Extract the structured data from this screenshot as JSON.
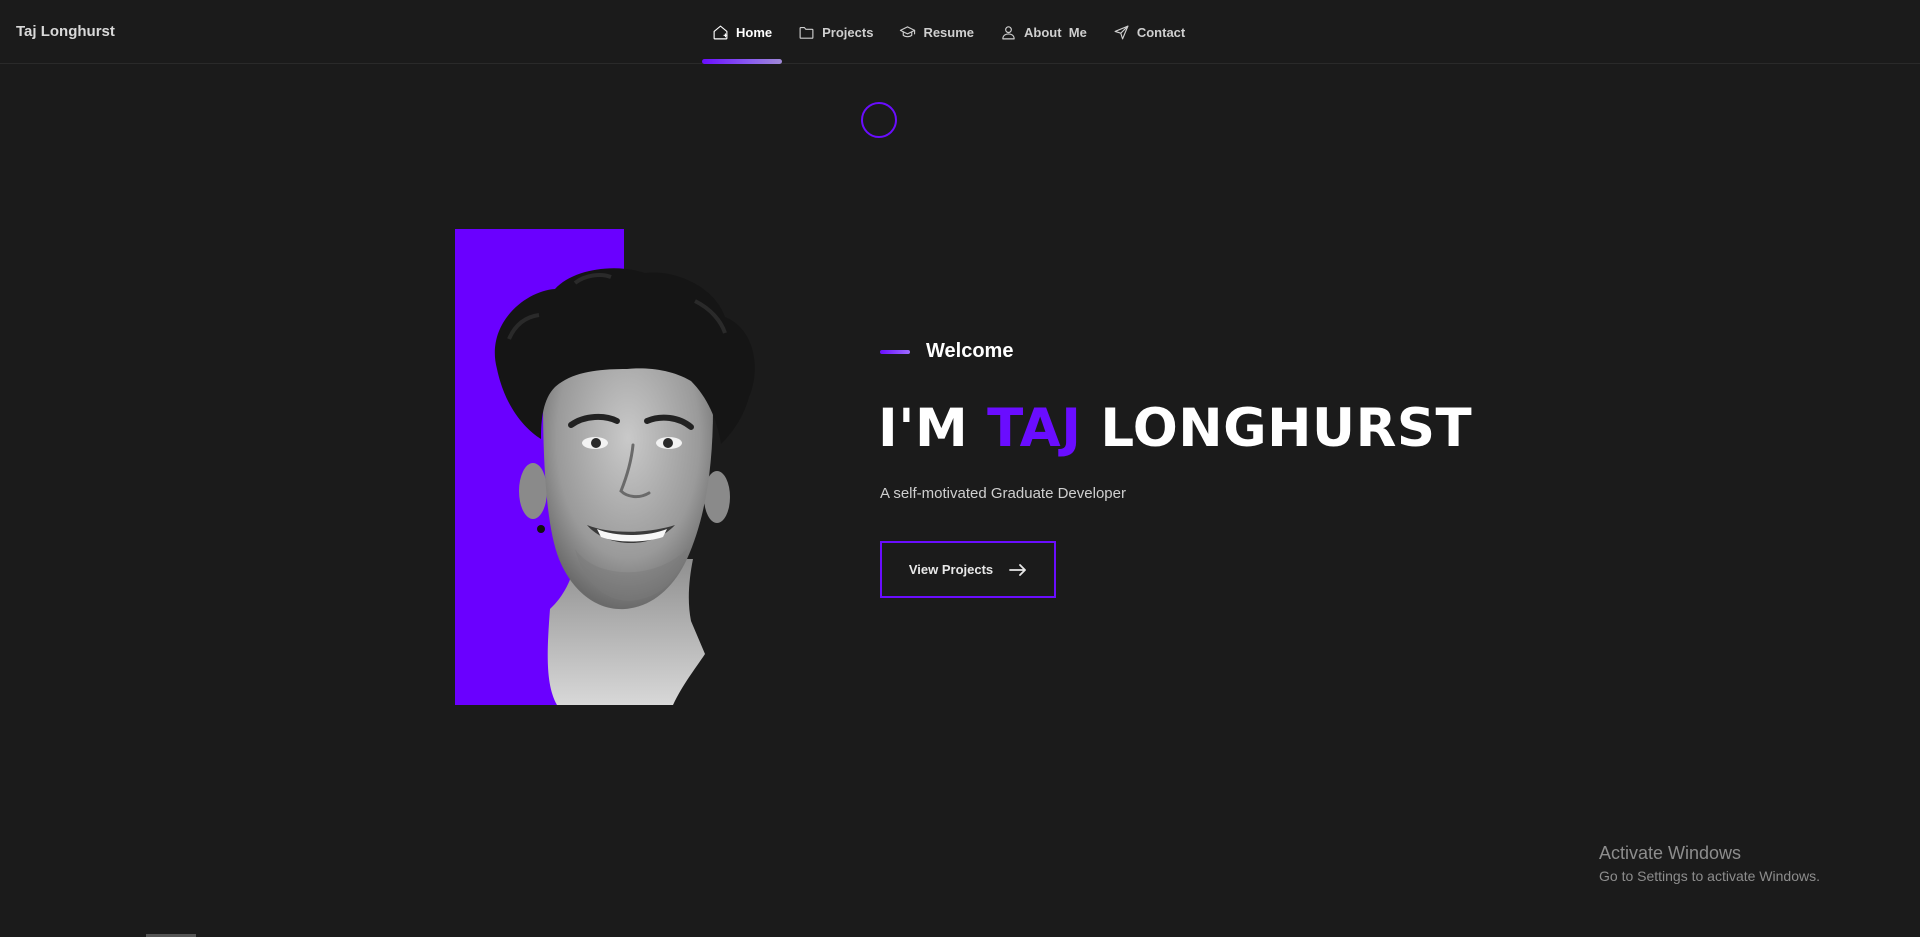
{
  "header": {
    "brand": "Taj Longhurst",
    "nav": [
      {
        "label": "Home",
        "icon": "home-icon",
        "active": true
      },
      {
        "label": "Projects",
        "icon": "folder-icon",
        "active": false
      },
      {
        "label": "Resume",
        "icon": "graduation-cap-icon",
        "active": false
      },
      {
        "label": "About  Me",
        "icon": "user-icon",
        "active": false
      },
      {
        "label": "Contact",
        "icon": "send-icon",
        "active": false
      }
    ]
  },
  "hero": {
    "welcome": "Welcome",
    "title_prefix": "I'M ",
    "title_highlight": "TAJ",
    "title_suffix": " LONGHURST",
    "subtitle": "A self-motivated Graduate Developer",
    "cta_label": "View Projects",
    "cta_icon": "arrow-right-icon"
  },
  "watermark": {
    "title": "Activate Windows",
    "subtitle": "Go to Settings to activate Windows."
  },
  "colors": {
    "background": "#1b1b1b",
    "accent": "#6a0dff",
    "text": "#ffffff",
    "muted": "#cfcfcf"
  }
}
